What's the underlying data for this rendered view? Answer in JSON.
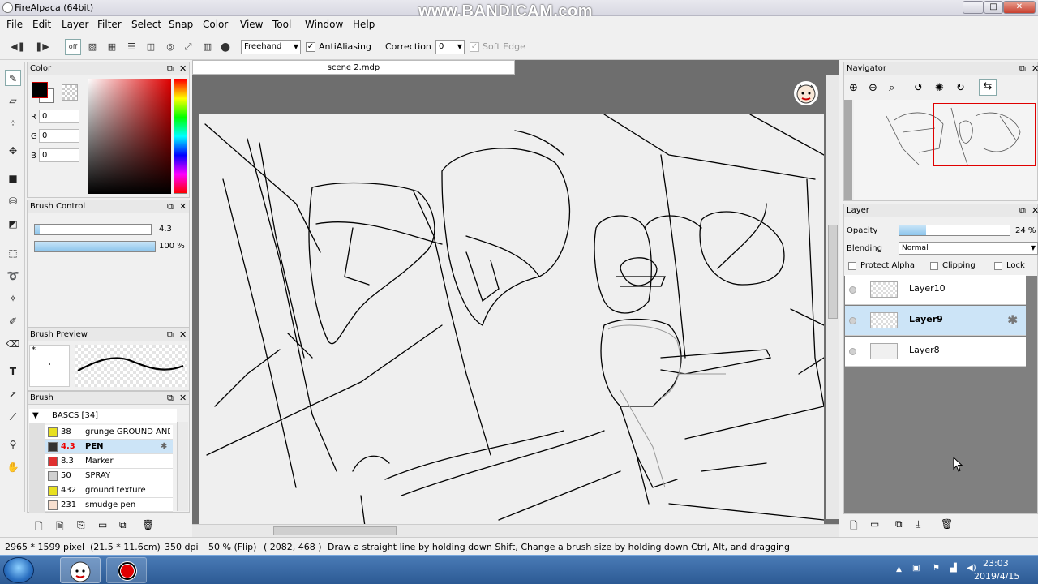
{
  "window": {
    "title": "FireAlpaca (64bit)",
    "watermark": "www.BANDICAM.com",
    "controls": [
      "─",
      "□",
      "✕"
    ]
  },
  "menu": [
    "File",
    "Edit",
    "Layer",
    "Filter",
    "Select",
    "Snap",
    "Color",
    "View",
    "Tool",
    "Window",
    "Help"
  ],
  "toolbar": {
    "brush_mode": "Freehand",
    "antialiasing_label": "AntiAliasing",
    "antialiasing_checked": "✓",
    "correction_label": "Correction",
    "correction_value": "0",
    "soft_edge_label": "Soft Edge",
    "soft_edge_checked": "✓",
    "aa_off_label": "off"
  },
  "color_panel": {
    "title": "Color",
    "r_label": "R",
    "r_value": "0",
    "g_label": "G",
    "g_value": "0",
    "b_label": "B",
    "b_value": "0",
    "primary_color": "#000000",
    "accent_red": "#e00000"
  },
  "brush_control": {
    "title": "Brush Control",
    "size_value": "4.3",
    "size_fraction": 0.04,
    "opacity_value": "100",
    "opacity_unit": "%",
    "opacity_fraction": 1.0
  },
  "brush_preview": {
    "title": "Brush Preview",
    "marker": "*"
  },
  "brush_list": {
    "title": "Brush",
    "group": "BASCS [34]",
    "items": [
      {
        "size": "38",
        "name": "grunge GROUND AND W",
        "color": "#e8e020"
      },
      {
        "size": "4.3",
        "name": "PEN",
        "color": "#333333"
      },
      {
        "size": "8.3",
        "name": "Marker",
        "color": "#e03030"
      },
      {
        "size": "50",
        "name": "SPRAY",
        "color": "#d0d0d0"
      },
      {
        "size": "432",
        "name": "ground texture",
        "color": "#e8e020"
      },
      {
        "size": "231",
        "name": "smudge pen",
        "color": "#f8e0d0"
      }
    ]
  },
  "document": {
    "tab": "scene 2.mdp"
  },
  "navigator": {
    "title": "Navigator"
  },
  "layer_panel": {
    "title": "Layer",
    "opacity_label": "Opacity",
    "opacity_value": "24",
    "opacity_unit": "%",
    "opacity_fraction": 0.24,
    "blending_label": "Blending",
    "blending_value": "Normal",
    "protect_alpha_label": "Protect Alpha",
    "clipping_label": "Clipping",
    "lock_label": "Lock",
    "layers": [
      {
        "name": "Layer10"
      },
      {
        "name": "Layer9"
      },
      {
        "name": "Layer8"
      }
    ]
  },
  "status": {
    "pixels": "2965 * 1599 pixel",
    "cm": "(21.5 * 11.6cm)",
    "dpi": "350 dpi",
    "zoom": "50 % (Flip)",
    "coords": "( 2082, 468 )",
    "hint": "Draw a straight line by holding down Shift, Change a brush size by holding down Ctrl, Alt, and dragging"
  },
  "taskbar": {
    "time": "23:03",
    "date": "2019/4/15"
  }
}
